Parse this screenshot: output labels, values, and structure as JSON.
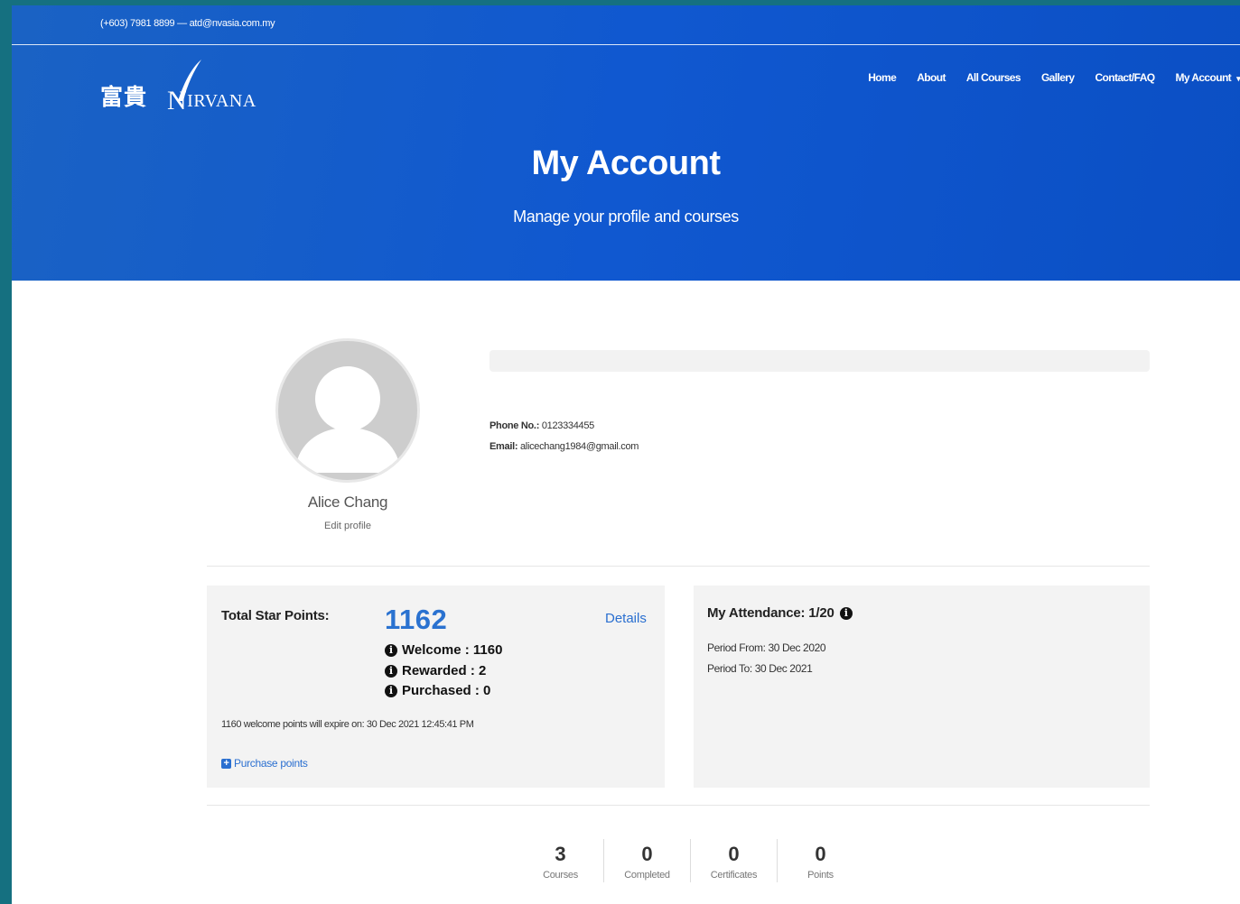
{
  "topbar": {
    "contact": "(+603) 7981 8899 — atd@nvasia.com.my"
  },
  "logo": {
    "chinese": "富貴",
    "first_letter": "N",
    "rest": "IRVANA"
  },
  "nav": {
    "items": [
      "Home",
      "About",
      "All Courses",
      "Gallery",
      "Contact/FAQ",
      "My Account"
    ]
  },
  "hero": {
    "title": "My Account",
    "subtitle": "Manage your profile and courses"
  },
  "profile": {
    "name": "Alice Chang",
    "edit_label": "Edit profile",
    "phone_label": "Phone No.:",
    "phone_value": "0123334455",
    "email_label": "Email:",
    "email_value": "alicechang1984@gmail.com"
  },
  "stars": {
    "label": "Total Star Points:",
    "total": "1162",
    "details_label": "Details",
    "breakdown": [
      {
        "label": "Welcome : 1160"
      },
      {
        "label": "Rewarded : 2"
      },
      {
        "label": "Purchased : 0"
      }
    ],
    "expire_note": "1160 welcome points will expire on: 30 Dec 2021 12:45:41 PM",
    "purchase_label": "Purchase points"
  },
  "attendance": {
    "title": "My Attendance: 1/20",
    "period_from": "Period From: 30 Dec 2020",
    "period_to": "Period To: 30 Dec 2021"
  },
  "stats": [
    {
      "value": "3",
      "label": "Courses"
    },
    {
      "value": "0",
      "label": "Completed"
    },
    {
      "value": "0",
      "label": "Certificates"
    },
    {
      "value": "0",
      "label": "Points"
    }
  ],
  "colors": {
    "hero_blue": "#1058d0",
    "link_blue": "#2a6fd0",
    "frame_teal": "#157080"
  }
}
